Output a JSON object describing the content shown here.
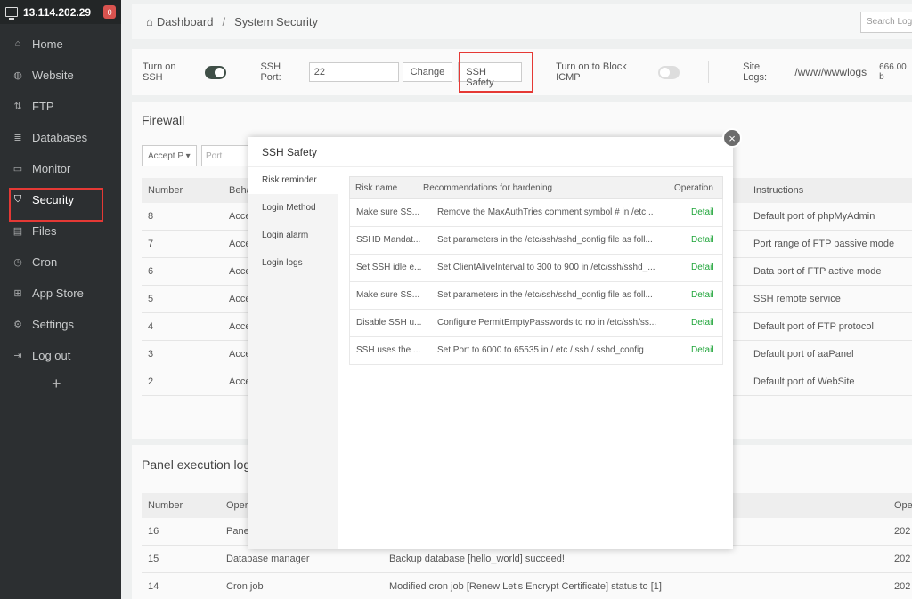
{
  "sidebar": {
    "ip": "13.114.202.29",
    "badge": "0",
    "items": [
      {
        "label": "Home",
        "icon": "home-icon"
      },
      {
        "label": "Website",
        "icon": "globe-icon"
      },
      {
        "label": "FTP",
        "icon": "ftp-icon"
      },
      {
        "label": "Databases",
        "icon": "database-icon"
      },
      {
        "label": "Monitor",
        "icon": "monitor-icon"
      },
      {
        "label": "Security",
        "icon": "shield-icon"
      },
      {
        "label": "Files",
        "icon": "folder-icon"
      },
      {
        "label": "Cron",
        "icon": "clock-icon"
      },
      {
        "label": "App Store",
        "icon": "grid-icon"
      },
      {
        "label": "Settings",
        "icon": "gear-icon"
      },
      {
        "label": "Log out",
        "icon": "logout-icon"
      }
    ],
    "active": "Security",
    "add": "+"
  },
  "breadcrumb": {
    "home": "Dashboard",
    "sep": "/",
    "current": "System Security"
  },
  "search": {
    "placeholder": "Search Logs"
  },
  "toolbar": {
    "ssh_label": "Turn on SSH",
    "ssh_on": true,
    "port_label": "SSH Port:",
    "port_value": "22",
    "change": "Change",
    "ssh_safety": "SSH Safety",
    "icmp_label": "Turn on to Block ICMP",
    "icmp_on": false,
    "site_logs_label": "Site Logs:",
    "site_logs_path": "/www/wwwlogs",
    "site_logs_size": "666.00 b"
  },
  "firewall": {
    "title": "Firewall",
    "select": "Accept P",
    "port_placeholder": "Port",
    "headers": {
      "number": "Number",
      "behavior": "Beha",
      "instructions": "Instructions"
    },
    "rows": [
      {
        "number": "8",
        "behavior": "Acce",
        "instructions": "Default port of phpMyAdmin"
      },
      {
        "number": "7",
        "behavior": "Acce",
        "instructions": "Port range of FTP passive mode"
      },
      {
        "number": "6",
        "behavior": "Acce",
        "instructions": "Data port of FTP active mode"
      },
      {
        "number": "5",
        "behavior": "Acce",
        "instructions": "SSH remote service"
      },
      {
        "number": "4",
        "behavior": "Acce",
        "instructions": "Default port of FTP protocol"
      },
      {
        "number": "3",
        "behavior": "Acce",
        "instructions": "Default port of aaPanel"
      },
      {
        "number": "2",
        "behavior": "Acce",
        "instructions": "Default port of WebSite"
      }
    ]
  },
  "logs": {
    "title": "Panel execution logs",
    "headers": {
      "number": "Number",
      "operation": "Opera",
      "time": "Ope"
    },
    "rows": [
      {
        "number": "16",
        "type": "Pane",
        "detail": "",
        "time": "202"
      },
      {
        "number": "15",
        "type": "Database manager",
        "detail": "Backup database [hello_world] succeed!",
        "time": "202"
      },
      {
        "number": "14",
        "type": "Cron job",
        "detail": "Modified cron job [Renew Let's Encrypt Certificate] status to [1]",
        "time": "202"
      }
    ]
  },
  "modal": {
    "title": "SSH Safety",
    "close": "×",
    "tabs": [
      "Risk reminder",
      "Login Method",
      "Login alarm",
      "Login logs"
    ],
    "headers": {
      "risk": "Risk name",
      "rec": "Recommendations for hardening",
      "op": "Operation"
    },
    "rows": [
      {
        "risk": "Make sure SS...",
        "rec": "Remove the MaxAuthTries comment symbol # in /etc...",
        "op": "Detail"
      },
      {
        "risk": "SSHD Mandat...",
        "rec": "Set parameters in the /etc/ssh/sshd_config file as foll...",
        "op": "Detail"
      },
      {
        "risk": "Set SSH idle e...",
        "rec": "Set ClientAliveInterval to 300 to 900 in /etc/ssh/sshd_...",
        "op": "Detail"
      },
      {
        "risk": "Make sure SS...",
        "rec": "Set parameters in the /etc/ssh/sshd_config file as foll...",
        "op": "Detail"
      },
      {
        "risk": "Disable SSH u...",
        "rec": "Configure PermitEmptyPasswords to no in /etc/ssh/ss...",
        "op": "Detail"
      },
      {
        "risk": "SSH uses the ...",
        "rec": "Set Port to 6000 to 65535 in / etc / ssh / sshd_config",
        "op": "Detail"
      }
    ]
  }
}
